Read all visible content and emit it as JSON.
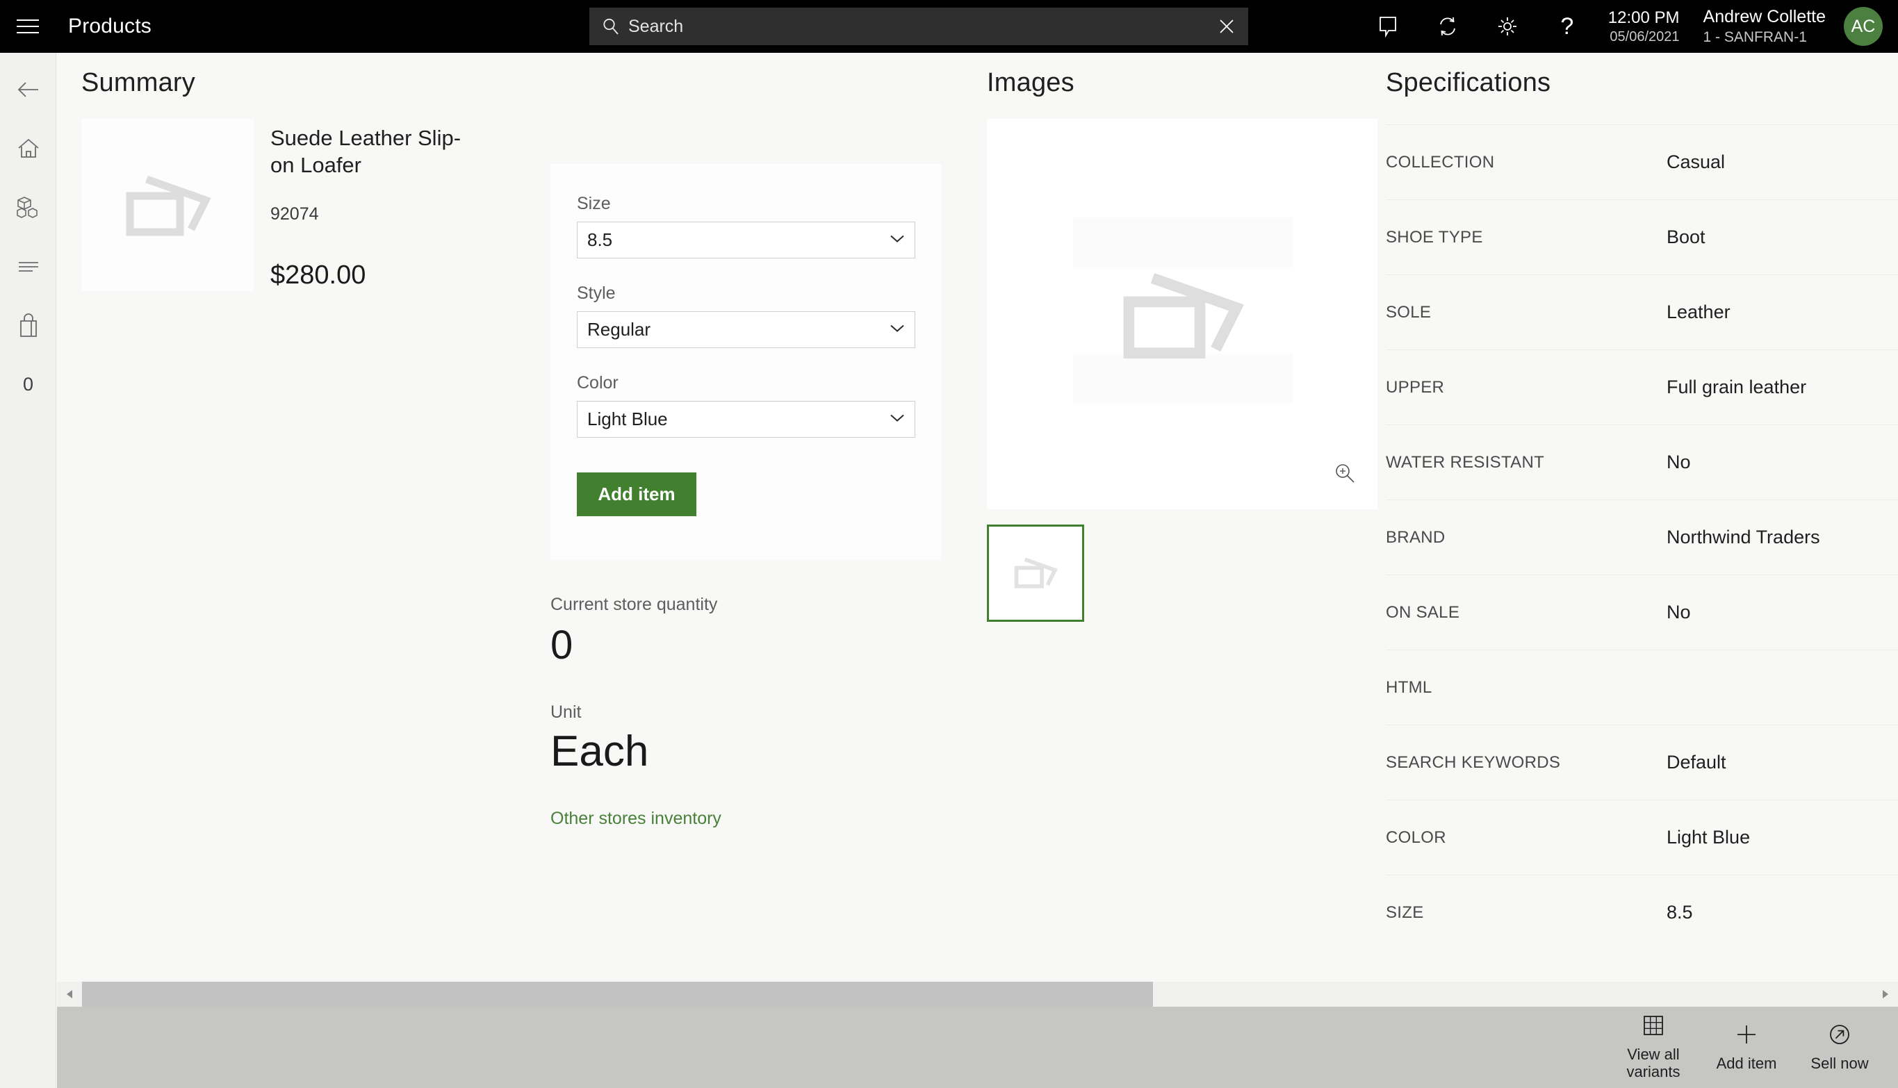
{
  "topbar": {
    "menu_icon": "hamburger-icon",
    "app_title": "Products",
    "search": {
      "placeholder": "Search",
      "value": "",
      "icon": "search-icon",
      "clear_icon": "close-icon"
    },
    "icons": [
      "message-icon",
      "sync-icon",
      "gear-icon",
      "help-icon"
    ],
    "help_glyph": "?",
    "time": "12:00 PM",
    "date": "05/06/2021",
    "user_name": "Andrew Collette",
    "user_store": "1 - SANFRAN-1",
    "avatar_initials": "AC",
    "avatar_color": "#4b8040"
  },
  "rail": {
    "items": [
      {
        "name": "back-arrow-icon",
        "label": "Back"
      },
      {
        "name": "home-icon",
        "label": "Home"
      },
      {
        "name": "products-icon",
        "label": "Products"
      },
      {
        "name": "list-icon",
        "label": "List"
      },
      {
        "name": "shopping-bag-icon",
        "label": "Cart"
      }
    ],
    "cart_count": "0"
  },
  "summary": {
    "title": "Summary",
    "product_name": "Suede Leather Slip-on Loafer",
    "product_sku": "92074",
    "product_price": "$280.00",
    "thumbnail_icon": "image-placeholder-icon"
  },
  "form": {
    "fields": [
      {
        "label": "Size",
        "value": "8.5",
        "options": [
          "8.5"
        ]
      },
      {
        "label": "Style",
        "value": "Regular",
        "options": [
          "Regular"
        ]
      },
      {
        "label": "Color",
        "value": "Light Blue",
        "options": [
          "Light Blue"
        ]
      }
    ],
    "add_item_label": "Add item",
    "accent_color": "#41802f"
  },
  "inventory": {
    "quantity_label": "Current store quantity",
    "quantity_value": "0",
    "unit_label": "Unit",
    "unit_value": "Each",
    "other_stores_link": "Other stores inventory",
    "link_color": "#4a8139"
  },
  "images": {
    "title": "Images",
    "main_icon": "image-placeholder-icon",
    "zoom_icon": "zoom-in-icon",
    "thumbnails": [
      {
        "icon": "image-placeholder-icon",
        "selected": true
      }
    ],
    "selected_border_color": "#41802f"
  },
  "specifications": {
    "title": "Specifications",
    "rows": [
      {
        "key": "COLLECTION",
        "value": "Casual"
      },
      {
        "key": "SHOE TYPE",
        "value": "Boot"
      },
      {
        "key": "SOLE",
        "value": "Leather"
      },
      {
        "key": "UPPER",
        "value": "Full grain leather"
      },
      {
        "key": "WATER RESISTANT",
        "value": "No"
      },
      {
        "key": "BRAND",
        "value": "Northwind Traders"
      },
      {
        "key": "ON SALE",
        "value": "No"
      },
      {
        "key": "HTML",
        "value": ""
      },
      {
        "key": "SEARCH KEYWORDS",
        "value": "Default"
      },
      {
        "key": "COLOR",
        "value": "Light Blue"
      },
      {
        "key": "SIZE",
        "value": "8.5"
      }
    ]
  },
  "scrollbar": {
    "left_arrow_icon": "chevron-left-icon",
    "right_arrow_icon": "chevron-right-icon"
  },
  "bottombar": {
    "actions": [
      {
        "icon": "grid-icon",
        "label": "View all variants"
      },
      {
        "icon": "plus-icon",
        "label": "Add item"
      },
      {
        "icon": "arrow-circle-icon",
        "label": "Sell now"
      }
    ]
  }
}
